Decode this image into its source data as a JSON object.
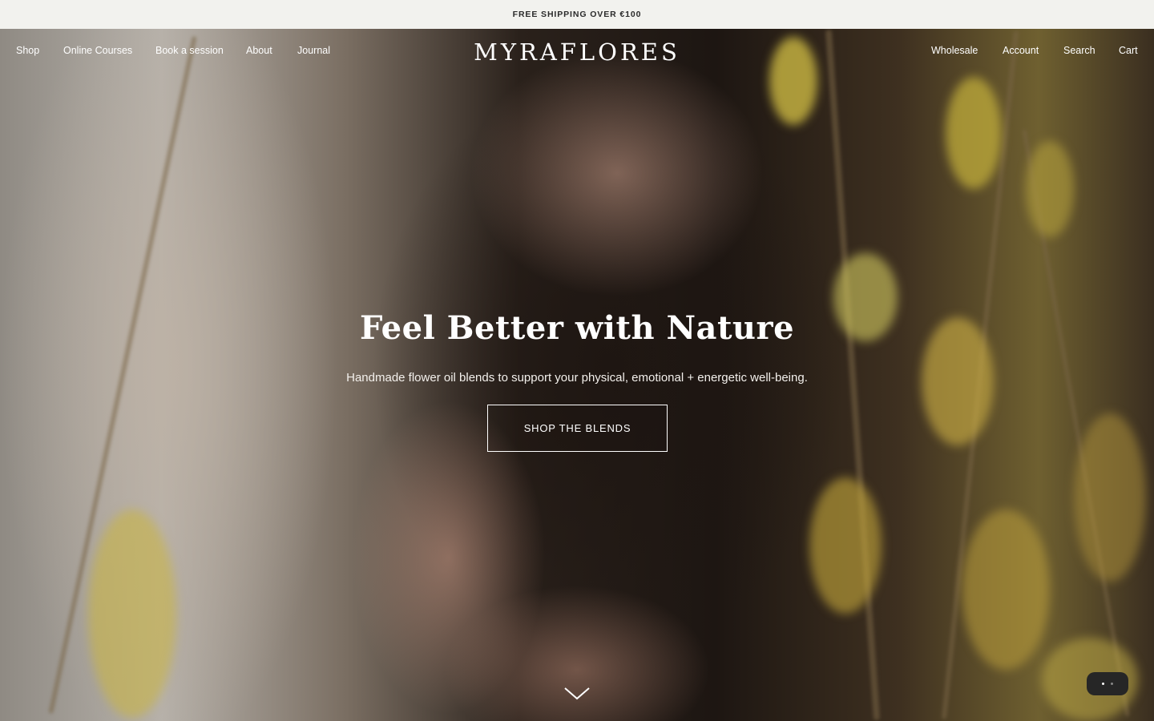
{
  "announcement": {
    "text": "FREE SHIPPING OVER €100"
  },
  "nav": {
    "left": [
      {
        "label": "Shop"
      },
      {
        "label": "Online Courses"
      },
      {
        "label": "Book a session"
      },
      {
        "label": "About"
      },
      {
        "label": "Journal"
      }
    ],
    "right": [
      {
        "label": "Wholesale"
      },
      {
        "label": "Account"
      },
      {
        "label": "Search"
      },
      {
        "label": "Cart"
      }
    ]
  },
  "brand": {
    "logo_text": "MYRAFLORES"
  },
  "hero": {
    "title": "Feel Better with Nature",
    "subtitle": "Handmade flower oil blends to support your physical, emotional + energetic well-being.",
    "cta_label": "SHOP THE BLENDS"
  },
  "icons": {
    "scroll": "chevron-down-icon",
    "chat": "chat-bubble-icon"
  }
}
